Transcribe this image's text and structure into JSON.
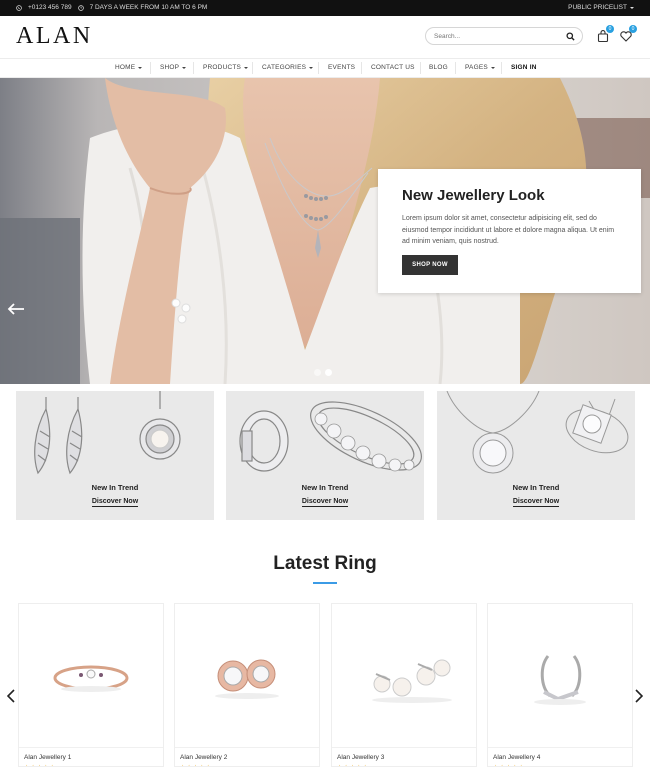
{
  "topbar": {
    "phone": "+0123 456 789",
    "hours": "7 DAYS A WEEK FROM 10 AM TO 6 PM",
    "pricelist": "PUBLIC PRICELIST"
  },
  "header": {
    "logo": "ALAN",
    "search_placeholder": "Search...",
    "cart_count": "0",
    "wishlist_count": "0"
  },
  "nav": {
    "items": [
      {
        "label": "HOME"
      },
      {
        "label": "SHOP"
      },
      {
        "label": "PRODUCTS"
      },
      {
        "label": "CATEGORIES"
      },
      {
        "label": "EVENTS"
      },
      {
        "label": "CONTACT US"
      },
      {
        "label": "BLOG"
      },
      {
        "label": "PAGES"
      },
      {
        "label": "SIGN IN"
      }
    ]
  },
  "hero": {
    "title": "New Jewellery Look",
    "text": "Lorem ipsum dolor sit amet, consectetur adipisicing elit, sed do eiusmod tempor incididunt ut labore et dolore magna aliqua. Ut enim ad minim veniam, quis nostrud.",
    "button": "SHOP NOW"
  },
  "banners": [
    {
      "title": "New In Trend",
      "link": "Discover Now"
    },
    {
      "title": "New In Trend",
      "link": "Discover Now"
    },
    {
      "title": "New In Trend",
      "link": "Discover Now"
    }
  ],
  "latest": {
    "title": "Latest Ring",
    "products": [
      {
        "name": "Alan Jewellery 1",
        "rating": "★★★★★"
      },
      {
        "name": "Alan Jewellery 2",
        "rating": "★★★★★"
      },
      {
        "name": "Alan Jewellery 3",
        "rating": "★★★★★"
      },
      {
        "name": "Alan Jewellery 4",
        "rating": "★★★★★"
      }
    ]
  },
  "colors": {
    "accent": "#3b9be6",
    "badge": "#29a0e0",
    "topbar": "#111111",
    "button": "#333333"
  }
}
